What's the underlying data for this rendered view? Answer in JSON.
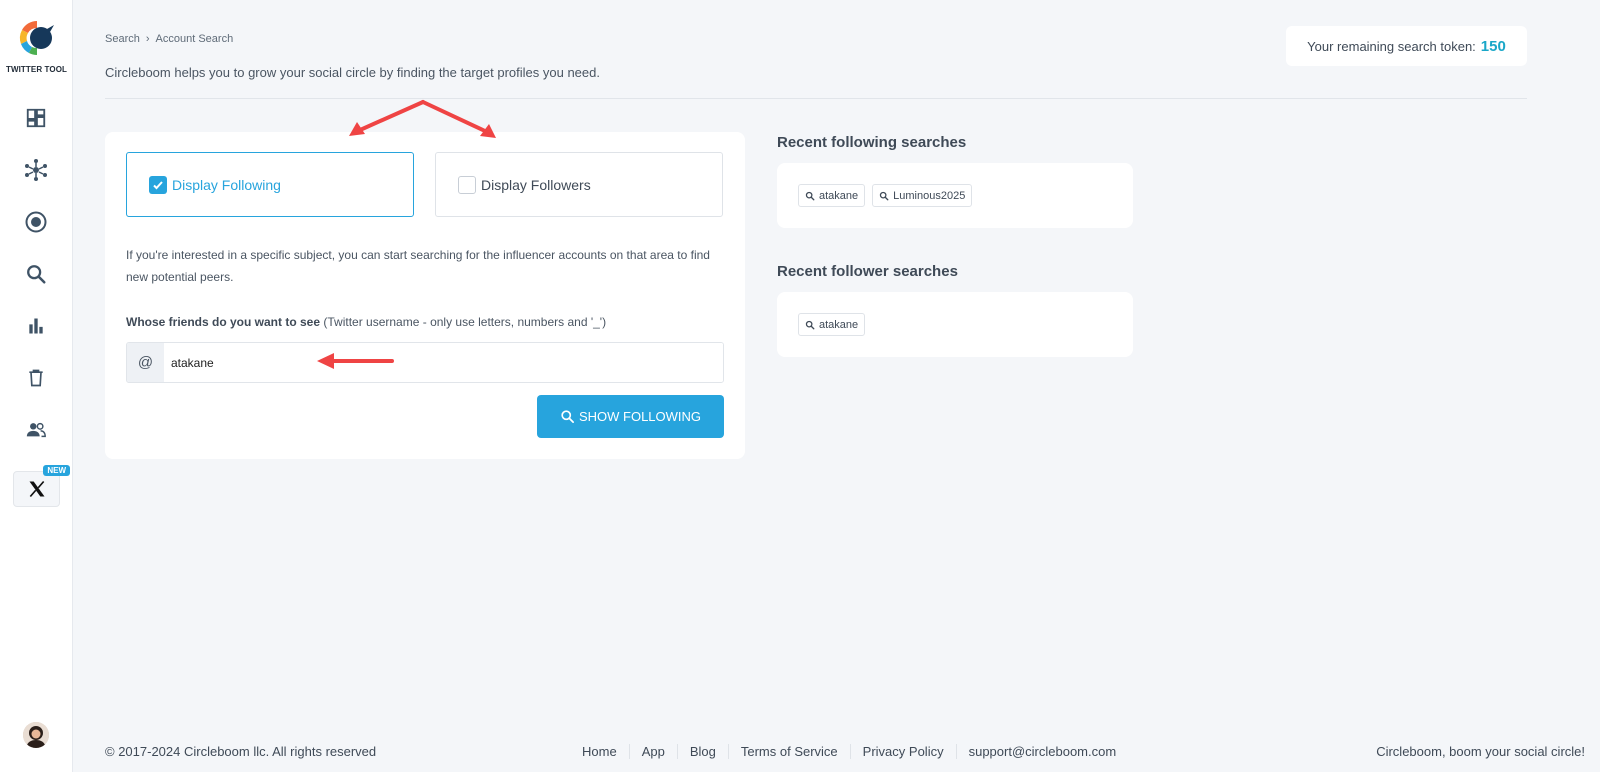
{
  "sidebar": {
    "logo_text": "TWITTER TOOL",
    "icons": [
      "dashboard-icon",
      "network-icon",
      "target-icon",
      "search-icon",
      "bar-chart-icon",
      "trash-icon",
      "people-icon",
      "x-logo-icon"
    ],
    "new_badge": "NEW"
  },
  "header": {
    "breadcrumb": [
      "Search",
      "Account Search"
    ],
    "subtitle": "Circleboom helps you to grow your social circle by finding the target profiles you need.",
    "token_label": "Your remaining search token:",
    "token_value": "150"
  },
  "card": {
    "option_following": "Display Following",
    "option_followers": "Display Followers",
    "following_checked": true,
    "followers_checked": false,
    "description": "If you're interested in a specific subject, you can start searching for the influencer accounts on that area to find new potential peers.",
    "field_label_bold": "Whose friends do you want to see",
    "field_label_hint": "(Twitter username - only use letters, numbers and '_')",
    "input_prefix": "@",
    "input_value": "atakane",
    "button_label": "SHOW FOLLOWING"
  },
  "recent": {
    "following_title": "Recent following searches",
    "following_items": [
      "atakane",
      "Luminous2025"
    ],
    "follower_title": "Recent follower searches",
    "follower_items": [
      "atakane"
    ]
  },
  "footer": {
    "copyright": "© 2017-2024 Circleboom llc. All rights reserved",
    "links": [
      "Home",
      "App",
      "Blog",
      "Terms of Service",
      "Privacy Policy",
      "support@circleboom.com"
    ],
    "tagline": "Circleboom, boom your social circle!"
  },
  "colors": {
    "accent": "#27a4dd",
    "token": "#1aa7c8",
    "annotation": "#ef4444"
  }
}
